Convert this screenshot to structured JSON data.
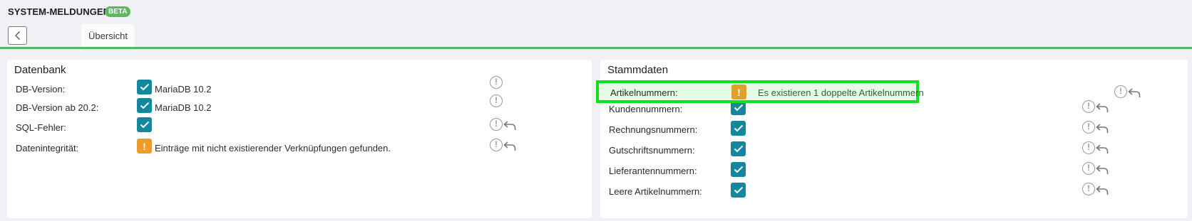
{
  "header": {
    "title": "SYSTEM-MELDUNGEN",
    "badge": "BETA",
    "back_icon": "chevron-left-icon",
    "tab_label": "Übersicht"
  },
  "colors": {
    "accent_green": "#4cb86a",
    "ok_teal": "#13879b",
    "warn_orange": "#ef9a2a",
    "highlight_green": "#12e11a"
  },
  "datenbank": {
    "title": "Datenbank",
    "rows": [
      {
        "label": "DB-Version:",
        "status": "ok",
        "value": "MariaDB 10.2"
      },
      {
        "label": "DB-Version ab 20.2:",
        "status": "ok",
        "value": "MariaDB 10.2"
      },
      {
        "label": "SQL-Fehler:",
        "status": "ok",
        "value": ""
      },
      {
        "label": "Datenintegrität:",
        "status": "warn",
        "value": "Einträge mit nicht existierender Verknüpfungen gefunden."
      }
    ]
  },
  "stammdaten": {
    "title": "Stammdaten",
    "rows": [
      {
        "label": "Artikelnummern:",
        "status": "warn",
        "value": "Es existieren 1 doppelte Artikelnummern"
      },
      {
        "label": "Kundennummern:",
        "status": "ok",
        "value": ""
      },
      {
        "label": "Rechnungsnummern:",
        "status": "ok",
        "value": ""
      },
      {
        "label": "Gutschriftsnummern:",
        "status": "ok",
        "value": ""
      },
      {
        "label": "Lieferantennummern:",
        "status": "ok",
        "value": ""
      },
      {
        "label": "Leere Artikelnummern:",
        "status": "ok",
        "value": ""
      }
    ]
  },
  "icons": {
    "ok": "checkmark-icon",
    "warn": "exclamation-icon",
    "info": "info-circle-icon",
    "undo": "undo-icon",
    "warn_glyph": "!",
    "info_glyph": "!"
  }
}
